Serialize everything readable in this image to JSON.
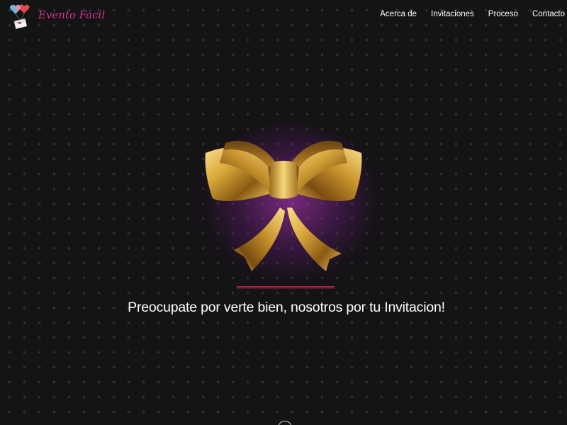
{
  "colors": {
    "background": "#141414",
    "brand": "#d6338f",
    "nav_text": "#ffffff",
    "divider": "#c31d43",
    "glow": "#c83cd2",
    "ribbon_gold": "#d9a93a"
  },
  "brand": {
    "name": "Evento Fácil",
    "logo_icon": "hearts-envelope-icon"
  },
  "nav": {
    "items": [
      {
        "label": "Acerca de"
      },
      {
        "label": "Invitaciones"
      },
      {
        "label": "Proceso"
      },
      {
        "label": "Contacto"
      }
    ]
  },
  "hero": {
    "image_icon": "gold-ribbon-bow-icon",
    "tagline": "Preocupate por verte bien, nosotros por tu Invitacion!"
  },
  "scroll": {
    "icon": "scroll-down-circle-icon"
  }
}
